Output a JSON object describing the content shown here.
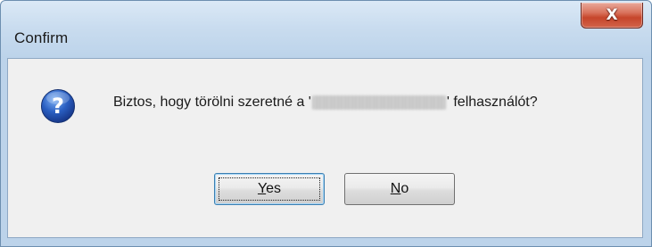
{
  "window": {
    "title": "Confirm",
    "close_glyph": "X"
  },
  "dialog": {
    "icon": "question-icon",
    "message_prefix": "Biztos, hogy törölni szeretné a '",
    "message_suffix": "' felhasználót?"
  },
  "buttons": {
    "yes": {
      "mnemonic": "Y",
      "rest": "es"
    },
    "no": {
      "mnemonic": "N",
      "rest": "o"
    }
  },
  "colors": {
    "frame": "#bcd3ea",
    "client": "#f0f0f0",
    "close": "#c6452b",
    "icon": "#2a5fc2"
  }
}
